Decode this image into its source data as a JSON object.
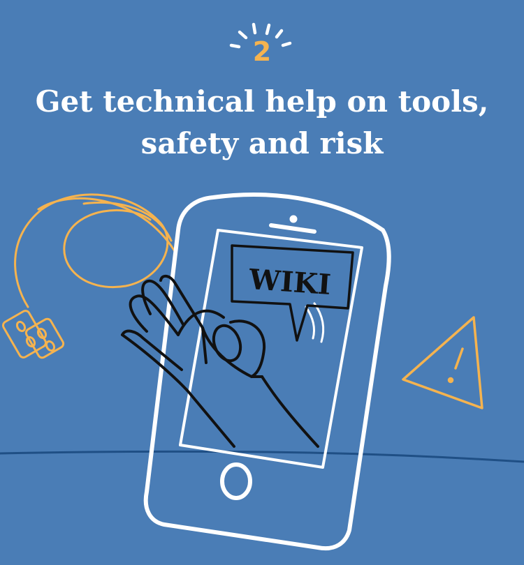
{
  "step": {
    "number": "2"
  },
  "headline": {
    "line1": "Get technical help on tools,",
    "line2": "safety and risk"
  },
  "illustration": {
    "speech_bubble_text": "WIKI",
    "icons": [
      "sparkle-rays-icon",
      "phone-icon",
      "ok-hand-icon",
      "speech-bubble-icon",
      "earphones-icon",
      "warning-triangle-icon"
    ]
  },
  "colors": {
    "background": "#4a7db6",
    "accent": "#f5b34f",
    "line": "#1f4f85",
    "stroke_light": "#ffffff",
    "stroke_dark": "#111111"
  }
}
